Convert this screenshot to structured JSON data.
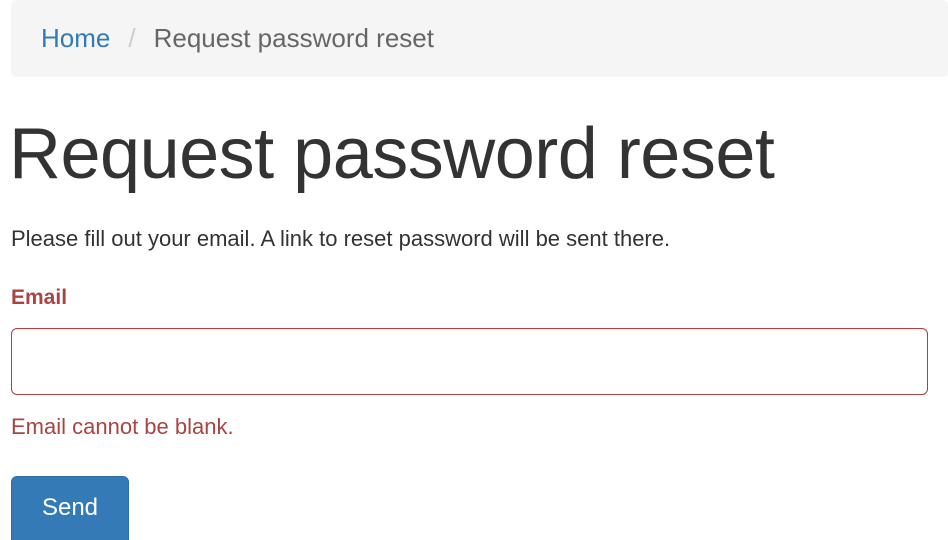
{
  "breadcrumb": {
    "home": "Home",
    "separator": "/",
    "current": "Request password reset"
  },
  "page": {
    "title": "Request password reset",
    "intro": "Please fill out your email. A link to reset password will be sent there."
  },
  "form": {
    "email_label": "Email",
    "email_value": "",
    "email_error": "Email cannot be blank.",
    "submit_label": "Send"
  },
  "colors": {
    "link": "#337ab7",
    "error": "#a94442",
    "primary_button": "#337ab7",
    "breadcrumb_bg": "#f5f5f5"
  }
}
